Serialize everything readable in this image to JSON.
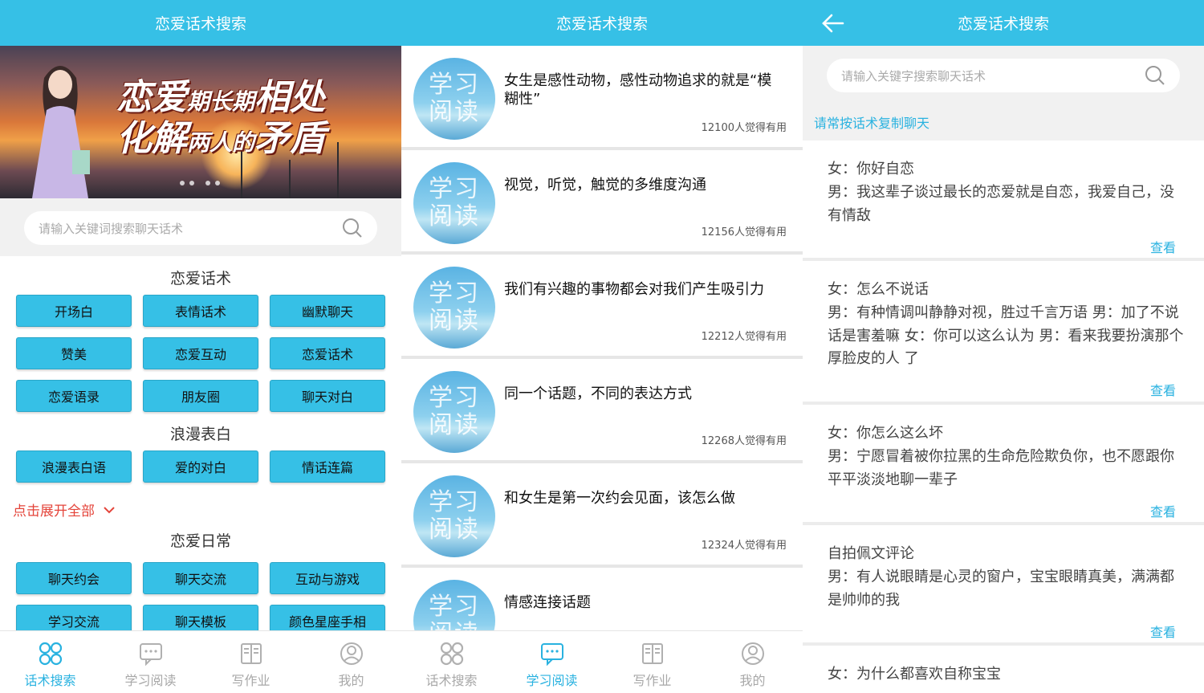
{
  "app_title": "恋爱话术搜索",
  "search_placeholder": "请输入关键词搜索聊天话术",
  "search_placeholder_alt": "请输入关键字搜索聊天话术",
  "banner": {
    "line1_big": "恋爱",
    "line1_small": "期长期",
    "line1_end": "相处",
    "line2_big": "化解",
    "line2_small": "两人的",
    "line2_end": "矛盾"
  },
  "sections": [
    {
      "title": "恋爱话术",
      "buttons": [
        "开场白",
        "表情话术",
        "幽默聊天",
        "赞美",
        "恋爱互动",
        "恋爱话术",
        "恋爱语录",
        "朋友圈",
        "聊天对白"
      ]
    },
    {
      "title": "浪漫表白",
      "buttons": [
        "浪漫表白语",
        "爱的对白",
        "情话连篇"
      ]
    },
    {
      "title": "恋爱日常",
      "buttons": [
        "聊天约会",
        "聊天交流",
        "互动与游戏",
        "学习交流",
        "聊天模板",
        "颜色星座手相"
      ]
    }
  ],
  "expand_label": "点击展开全部",
  "tabs": [
    "话术搜索",
    "学习阅读",
    "写作业",
    "我的"
  ],
  "thumb_text": [
    "学习",
    "阅读"
  ],
  "articles": [
    {
      "title": "女生是感性动物，感性动物追求的就是“模糊性”",
      "count": "12100人觉得有用"
    },
    {
      "title": "视觉，听觉，触觉的多维度沟通",
      "count": "12156人觉得有用"
    },
    {
      "title": "我们有兴趣的事物都会对我们产生吸引力",
      "count": "12212人觉得有用"
    },
    {
      "title": "同一个话题，不同的表达方式",
      "count": "12268人觉得有用"
    },
    {
      "title": "和女生是第一次约会见面，该怎么做",
      "count": "12324人觉得有用"
    },
    {
      "title": "情感连接话题",
      "count": ""
    }
  ],
  "hint_text": "请常按话术复制聊天",
  "view_label": "查看",
  "cards": [
    {
      "lines": [
        "女：你好自恋",
        "男：我这辈子谈过最长的恋爱就是自恋，我爱自己，没有情敌"
      ]
    },
    {
      "lines": [
        "女：怎么不说话",
        "男：有种情调叫静静对视，胜过千言万语 男：加了不说话是害羞嘛 女：你可以这么认为 男：看来我要扮演那个厚脸皮的人 了"
      ]
    },
    {
      "lines": [
        "女：你怎么这么坏",
        "男：宁愿冒着被你拉黑的生命危险欺负你，也不愿跟你平平淡淡地聊一辈子"
      ]
    },
    {
      "lines": [
        "自拍佩文评论",
        "男：有人说眼睛是心灵的窗户，宝宝眼睛真美，满满都是帅帅的我"
      ]
    },
    {
      "lines": [
        "女：为什么都喜欢自称宝宝"
      ]
    }
  ],
  "colors": {
    "accent": "#36c0e6",
    "link": "#29b2e0",
    "expand": "#e4443a"
  }
}
